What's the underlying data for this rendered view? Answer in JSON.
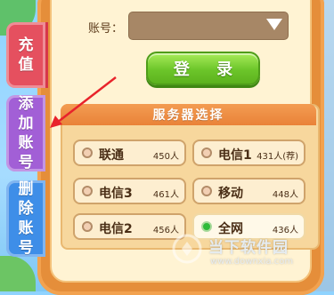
{
  "tabs": {
    "recharge": [
      "充",
      "值"
    ],
    "add_account": [
      "添",
      "加",
      "账",
      "号"
    ],
    "delete_account": [
      "删",
      "除",
      "账",
      "号"
    ]
  },
  "account": {
    "label": "账号：",
    "value": ""
  },
  "login_button": "登 录",
  "server_section": {
    "title": "服务器选择",
    "servers": [
      {
        "name": "联通",
        "count": "450人",
        "selected": false
      },
      {
        "name": "电信1",
        "count": "431人(荐)",
        "selected": false
      },
      {
        "name": "电信3",
        "count": "461人",
        "selected": false
      },
      {
        "name": "移动",
        "count": "448人",
        "selected": false
      },
      {
        "name": "电信2",
        "count": "456人",
        "selected": false
      },
      {
        "name": "全网",
        "count": "436人",
        "selected": true
      }
    ]
  },
  "watermark": {
    "title": "当下软件园",
    "url": "www.downxia.com"
  },
  "colors": {
    "panel_orange": "#e58e3a",
    "recharge_tab": "#e5505f",
    "add_tab": "#a25fd6",
    "delete_tab": "#3e8ee8",
    "login_green": "#6cc52a",
    "annotation_arrow": "#e8232b"
  }
}
